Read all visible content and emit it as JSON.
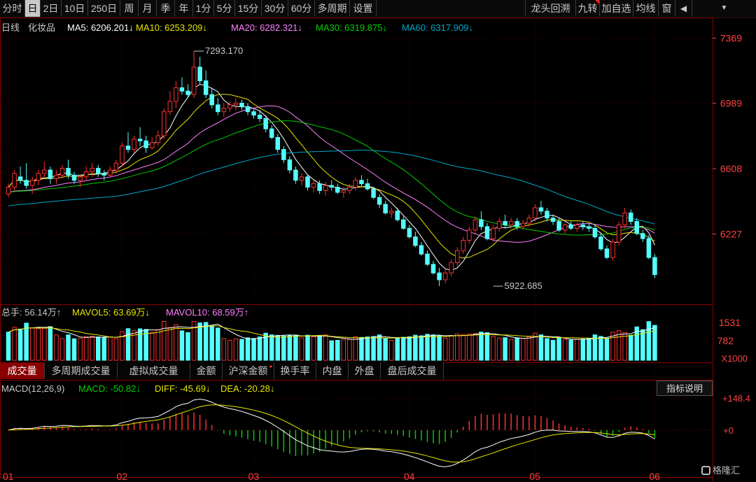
{
  "toolbar": {
    "left": [
      {
        "label": "分时",
        "active": false
      },
      {
        "label": "日",
        "active": true
      },
      {
        "label": "2日",
        "active": false
      },
      {
        "label": "10日",
        "active": false
      },
      {
        "label": "250日",
        "active": false
      },
      {
        "label": "周",
        "active": false
      },
      {
        "label": "月",
        "active": false
      },
      {
        "label": "季",
        "active": false
      },
      {
        "label": "年",
        "active": false
      },
      {
        "label": "1分",
        "active": false
      },
      {
        "label": "5分",
        "active": false
      },
      {
        "label": "15分",
        "active": false
      },
      {
        "label": "30分",
        "active": false
      },
      {
        "label": "60分",
        "active": false
      },
      {
        "label": "多周期",
        "active": false
      },
      {
        "label": "设置",
        "active": false
      }
    ],
    "right": [
      "龙头回溯",
      "九转",
      "加自选",
      "均线",
      "窗"
    ],
    "back_icon": "back-icon",
    "menu_icon": "chevron-down-icon"
  },
  "colors": {
    "up": "#ff3030",
    "down": "#54ffff",
    "ma5": "#ffffff",
    "ma10": "#e6e600",
    "ma20": "#ff80ff",
    "ma30": "#00cc00",
    "ma60": "#00a8c8",
    "axis": "#8a0000",
    "grid": "#500000"
  },
  "price_legend": {
    "period": "日线",
    "name": "化妆品",
    "ma5": "MA5: 6206.201↓",
    "ma10": "MA10: 6253.209↓",
    "ma20": "MA20: 6282.321↓",
    "ma30": "MA30: 6319.875↓",
    "ma60": "MA60: 6317.909↓"
  },
  "volume_legend": {
    "total": "总手: 56.14万↑",
    "mavol5": "MAVOL5: 63.69万↓",
    "mavol10": "MAVOL10: 68.59万↑"
  },
  "macd_legend": {
    "title": "MACD(12,26,9)",
    "macd": "MACD: -50.82↓",
    "diff": "DIFF: -45.69↓",
    "dea": "DEA: -20.28↓"
  },
  "subtabs": [
    {
      "label": "成交量",
      "active": true
    },
    {
      "label": "多周期成交量",
      "active": false
    },
    {
      "label": "虚拟成交量",
      "active": false
    },
    {
      "label": "金额",
      "active": false
    },
    {
      "label": "沪深金额",
      "active": false
    },
    {
      "label": "换手率",
      "active": false
    },
    {
      "label": "内盘",
      "active": false
    },
    {
      "label": "外盘",
      "active": false
    },
    {
      "label": "盘后成交量",
      "active": false
    }
  ],
  "help_label": "指标说明",
  "logo_text": "格隆汇",
  "chart_data": {
    "type": "candlestick",
    "price_axis": {
      "ticks": [
        6227,
        6608,
        6989,
        7369
      ],
      "ylim": [
        5870,
        7420
      ]
    },
    "volume_axis": {
      "ticks": [
        "1531",
        "782"
      ],
      "unit": "X1000",
      "ylim": [
        0,
        1700
      ]
    },
    "macd_axis": {
      "ticks": [
        "+148.4",
        "+0"
      ],
      "ylim": [
        -170,
        175
      ]
    },
    "months": [
      {
        "label": "01",
        "index": 0
      },
      {
        "label": "02",
        "index": 19
      },
      {
        "label": "03",
        "index": 41
      },
      {
        "label": "04",
        "index": 67
      },
      {
        "label": "05",
        "index": 88
      },
      {
        "label": "06",
        "index": 108
      }
    ],
    "annotations": [
      {
        "label": "7293.170",
        "index": 31,
        "value": 7293.17
      },
      {
        "label": "5922.685",
        "index": 81,
        "value": 5922.685
      }
    ],
    "ohlc": [
      [
        6460,
        6520,
        6440,
        6500
      ],
      [
        6500,
        6600,
        6480,
        6580
      ],
      [
        6560,
        6620,
        6520,
        6540
      ],
      [
        6540,
        6640,
        6490,
        6510
      ],
      [
        6510,
        6560,
        6460,
        6540
      ],
      [
        6540,
        6600,
        6510,
        6580
      ],
      [
        6580,
        6650,
        6560,
        6600
      ],
      [
        6600,
        6620,
        6520,
        6550
      ],
      [
        6550,
        6600,
        6520,
        6570
      ],
      [
        6570,
        6630,
        6550,
        6610
      ],
      [
        6610,
        6660,
        6550,
        6570
      ],
      [
        6570,
        6590,
        6520,
        6540
      ],
      [
        6540,
        6570,
        6500,
        6560
      ],
      [
        6560,
        6620,
        6540,
        6590
      ],
      [
        6590,
        6640,
        6560,
        6610
      ],
      [
        6610,
        6630,
        6560,
        6580
      ],
      [
        6580,
        6600,
        6540,
        6570
      ],
      [
        6570,
        6620,
        6560,
        6600
      ],
      [
        6600,
        6660,
        6580,
        6640
      ],
      [
        6640,
        6760,
        6620,
        6740
      ],
      [
        6740,
        6820,
        6700,
        6720
      ],
      [
        6720,
        6800,
        6700,
        6780
      ],
      [
        6780,
        6850,
        6740,
        6770
      ],
      [
        6770,
        6800,
        6700,
        6730
      ],
      [
        6730,
        6790,
        6720,
        6760
      ],
      [
        6760,
        6830,
        6740,
        6800
      ],
      [
        6800,
        6960,
        6780,
        6940
      ],
      [
        6940,
        7060,
        6920,
        7000
      ],
      [
        7000,
        7120,
        6960,
        7080
      ],
      [
        7080,
        7140,
        7040,
        7060
      ],
      [
        7060,
        7100,
        7020,
        7040
      ],
      [
        7040,
        7293,
        7020,
        7200
      ],
      [
        7200,
        7260,
        7100,
        7120
      ],
      [
        7120,
        7180,
        7020,
        7040
      ],
      [
        7040,
        7080,
        6960,
        6980
      ],
      [
        6980,
        7020,
        6920,
        6940
      ],
      [
        6940,
        6990,
        6910,
        6960
      ],
      [
        6960,
        7000,
        6940,
        6980
      ],
      [
        6980,
        7020,
        6950,
        6990
      ],
      [
        6990,
        7010,
        6950,
        6970
      ],
      [
        6970,
        6990,
        6920,
        6940
      ],
      [
        6940,
        6960,
        6900,
        6920
      ],
      [
        6920,
        6950,
        6880,
        6900
      ],
      [
        6900,
        6920,
        6820,
        6840
      ],
      [
        6840,
        6860,
        6780,
        6790
      ],
      [
        6790,
        6810,
        6700,
        6720
      ],
      [
        6720,
        6740,
        6640,
        6660
      ],
      [
        6660,
        6680,
        6580,
        6600
      ],
      [
        6600,
        6620,
        6520,
        6540
      ],
      [
        6540,
        6580,
        6510,
        6560
      ],
      [
        6560,
        6570,
        6480,
        6500
      ],
      [
        6500,
        6540,
        6470,
        6520
      ],
      [
        6520,
        6540,
        6460,
        6480
      ],
      [
        6480,
        6530,
        6450,
        6510
      ],
      [
        6510,
        6540,
        6480,
        6500
      ],
      [
        6500,
        6520,
        6460,
        6470
      ],
      [
        6470,
        6500,
        6440,
        6480
      ],
      [
        6480,
        6520,
        6460,
        6500
      ],
      [
        6500,
        6560,
        6480,
        6540
      ],
      [
        6540,
        6570,
        6500,
        6520
      ],
      [
        6520,
        6550,
        6480,
        6490
      ],
      [
        6490,
        6500,
        6430,
        6440
      ],
      [
        6440,
        6460,
        6380,
        6400
      ],
      [
        6400,
        6420,
        6340,
        6350
      ],
      [
        6350,
        6380,
        6320,
        6360
      ],
      [
        6360,
        6380,
        6300,
        6310
      ],
      [
        6310,
        6330,
        6250,
        6260
      ],
      [
        6260,
        6280,
        6200,
        6210
      ],
      [
        6210,
        6240,
        6150,
        6160
      ],
      [
        6160,
        6180,
        6100,
        6110
      ],
      [
        6110,
        6130,
        6040,
        6050
      ],
      [
        6050,
        6070,
        5990,
        6000
      ],
      [
        6000,
        6030,
        5923,
        5960
      ],
      [
        5960,
        6020,
        5940,
        6000
      ],
      [
        6000,
        6080,
        5980,
        6060
      ],
      [
        6060,
        6150,
        6040,
        6130
      ],
      [
        6130,
        6210,
        6110,
        6190
      ],
      [
        6190,
        6270,
        6170,
        6250
      ],
      [
        6250,
        6330,
        6230,
        6310
      ],
      [
        6310,
        6360,
        6250,
        6270
      ],
      [
        6270,
        6290,
        6190,
        6200
      ],
      [
        6200,
        6280,
        6180,
        6260
      ],
      [
        6260,
        6320,
        6240,
        6300
      ],
      [
        6300,
        6340,
        6260,
        6280
      ],
      [
        6280,
        6320,
        6260,
        6300
      ],
      [
        6300,
        6320,
        6250,
        6270
      ],
      [
        6270,
        6310,
        6250,
        6290
      ],
      [
        6290,
        6340,
        6270,
        6320
      ],
      [
        6320,
        6400,
        6300,
        6380
      ],
      [
        6380,
        6420,
        6340,
        6360
      ],
      [
        6360,
        6380,
        6300,
        6320
      ],
      [
        6320,
        6340,
        6280,
        6300
      ],
      [
        6300,
        6320,
        6240,
        6250
      ],
      [
        6250,
        6290,
        6230,
        6280
      ],
      [
        6280,
        6300,
        6250,
        6260
      ],
      [
        6260,
        6290,
        6240,
        6280
      ],
      [
        6280,
        6300,
        6250,
        6270
      ],
      [
        6270,
        6290,
        6240,
        6260
      ],
      [
        6260,
        6280,
        6200,
        6210
      ],
      [
        6210,
        6230,
        6130,
        6140
      ],
      [
        6140,
        6160,
        6080,
        6090
      ],
      [
        6090,
        6200,
        6070,
        6180
      ],
      [
        6180,
        6300,
        6160,
        6280
      ],
      [
        6280,
        6380,
        6260,
        6350
      ],
      [
        6350,
        6370,
        6280,
        6300
      ],
      [
        6300,
        6320,
        6220,
        6230
      ],
      [
        6230,
        6250,
        6180,
        6200
      ],
      [
        6200,
        6220,
        6080,
        6090
      ],
      [
        6090,
        6110,
        5970,
        5990
      ]
    ],
    "volume_up": [
      false,
      true,
      false,
      false,
      true,
      true,
      true,
      false,
      true,
      true,
      false,
      false,
      true,
      true,
      true,
      false,
      false,
      true,
      true,
      true,
      false,
      true,
      false,
      false,
      true,
      true,
      true,
      true,
      true,
      false,
      false,
      true,
      false,
      false,
      false,
      false,
      true,
      true,
      true,
      false,
      false,
      false,
      false,
      false,
      false,
      false,
      false,
      false,
      false,
      true,
      false,
      true,
      false,
      true,
      false,
      false,
      true,
      true,
      true,
      false,
      false,
      false,
      false,
      false,
      true,
      false,
      false,
      false,
      false,
      false,
      false,
      false,
      false,
      true,
      true,
      true,
      true,
      true,
      true,
      false,
      false,
      true,
      true,
      false,
      true,
      false,
      true,
      true,
      true,
      false,
      false,
      false,
      false,
      true,
      false,
      true,
      false,
      false,
      false,
      false,
      false,
      true,
      true,
      true,
      false,
      false,
      false,
      false,
      false
    ]
  }
}
